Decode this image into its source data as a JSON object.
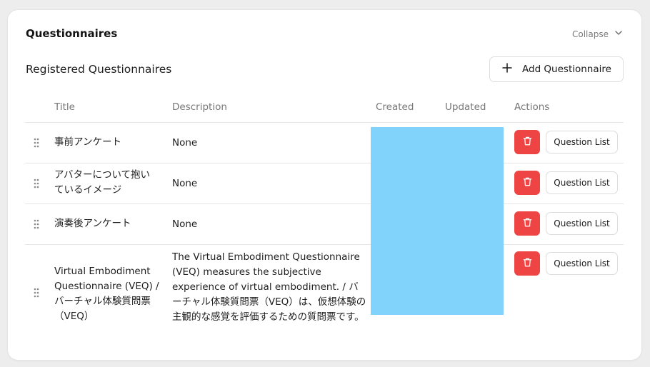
{
  "card": {
    "title": "Questionnaires",
    "collapse_label": "Collapse"
  },
  "section": {
    "title": "Registered Questionnaires",
    "add_button_label": "Add Questionnaire"
  },
  "table": {
    "columns": [
      "Title",
      "Description",
      "Created",
      "Updated",
      "Actions"
    ],
    "rows": [
      {
        "title": "事前アンケート",
        "description": "None",
        "action_label": "Question List"
      },
      {
        "title": "アバターについて抱いているイメージ",
        "description": "None",
        "action_label": "Question List"
      },
      {
        "title": "演奏後アンケート",
        "description": "None",
        "action_label": "Question List"
      },
      {
        "title": "Virtual Embodiment Questionnaire (VEQ) / バーチャル体験質問票（VEQ）",
        "description": "The Virtual Embodiment Questionnaire (VEQ) measures the subjective experience of virtual embodiment. / バーチャル体験質問票（VEQ）は、仮想体験の主観的な感覚を評価するための質問票です。",
        "action_label": "Question List"
      }
    ]
  },
  "colors": {
    "delete": "#ef4444",
    "redaction": "#82d3fb"
  },
  "icons": {
    "collapse": "chevron-down-icon",
    "add": "plus-icon",
    "drag": "drag-handle-icon",
    "delete": "trash-icon"
  }
}
